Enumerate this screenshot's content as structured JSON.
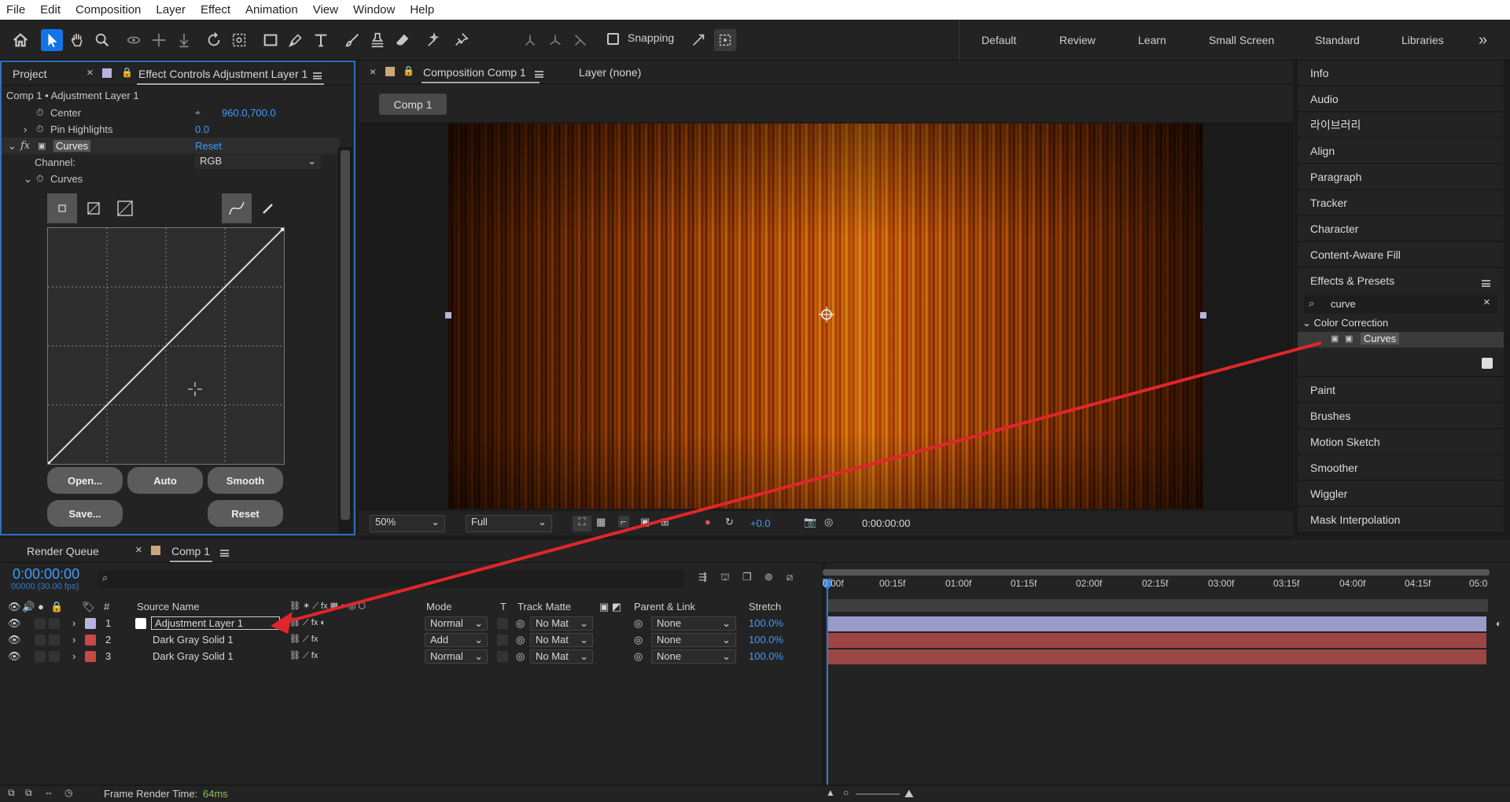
{
  "menu": [
    "File",
    "Edit",
    "Composition",
    "Layer",
    "Effect",
    "Animation",
    "View",
    "Window",
    "Help"
  ],
  "toolbar": {
    "snapping_label": "Snapping"
  },
  "workspaces": [
    "Default",
    "Review",
    "Learn",
    "Small Screen",
    "Standard",
    "Libraries"
  ],
  "workspace_more": "»",
  "left_panel": {
    "tab_project": "Project",
    "tab_effect_controls": "Effect Controls Adjustment Layer 1",
    "breadcrumb": "Comp 1 • Adjustment Layer 1",
    "props": [
      {
        "name": "Center",
        "value": "960.0,700.0"
      },
      {
        "name": "Pin Highlights",
        "value": "0.0"
      }
    ],
    "effect_name": "Curves",
    "effect_reset": "Reset",
    "channel_label": "Channel:",
    "channel_value": "RGB",
    "curves_label": "Curves",
    "buttons": {
      "open": "Open...",
      "auto": "Auto",
      "smooth": "Smooth",
      "save": "Save...",
      "reset": "Reset"
    }
  },
  "viewer": {
    "tab_composition": "Composition Comp 1",
    "tab_layer": "Layer (none)",
    "comp_button": "Comp 1",
    "zoom": "50%",
    "resolution": "Full",
    "exposure": "+0.0",
    "timecode": "0:00:00:00"
  },
  "right_panel": {
    "items_top": [
      "Info",
      "Audio",
      "라이브러리",
      "Align",
      "Paragraph",
      "Tracker",
      "Character",
      "Content-Aware Fill"
    ],
    "effects_title": "Effects & Presets",
    "search_value": "curve",
    "category": "Color Correction",
    "result": "Curves",
    "items_bottom": [
      "Paint",
      "Brushes",
      "Motion Sketch",
      "Smoother",
      "Wiggler",
      "Mask Interpolation"
    ]
  },
  "timeline": {
    "tab_render": "Render Queue",
    "tab_comp": "Comp 1",
    "timecode": "0:00:00:00",
    "frames": "00000 (30.00 fps)",
    "headers": {
      "source": "Source Name",
      "mode": "Mode",
      "t": "T",
      "track_matte": "Track Matte",
      "parent": "Parent & Link",
      "stretch": "Stretch"
    },
    "layers": [
      {
        "num": "1",
        "name": "Adjustment Layer 1",
        "mode": "Normal",
        "matte": "No Mat",
        "parent": "None",
        "stretch": "100.0%",
        "label_color": "#b7b4e0",
        "bar_color": "#9a9ac8"
      },
      {
        "num": "2",
        "name": "Dark Gray Solid 1",
        "mode": "Add",
        "matte": "No Mat",
        "parent": "None",
        "stretch": "100.0%",
        "label_color": "#c84848",
        "bar_color": "#9c4545"
      },
      {
        "num": "3",
        "name": "Dark Gray Solid 1",
        "mode": "Normal",
        "matte": "No Mat",
        "parent": "None",
        "stretch": "100.0%",
        "label_color": "#c84848",
        "bar_color": "#9c4545"
      }
    ],
    "ruler": [
      "0:00f",
      "00:15f",
      "01:00f",
      "01:15f",
      "02:00f",
      "02:15f",
      "03:00f",
      "03:15f",
      "04:00f",
      "04:15f",
      "05:0"
    ],
    "render_time_label": "Frame Render Time:",
    "render_time_value": "64ms"
  },
  "colors": {
    "accent": "#1473e6",
    "value_blue": "#3d9dff",
    "arrow": "#e0262b"
  }
}
